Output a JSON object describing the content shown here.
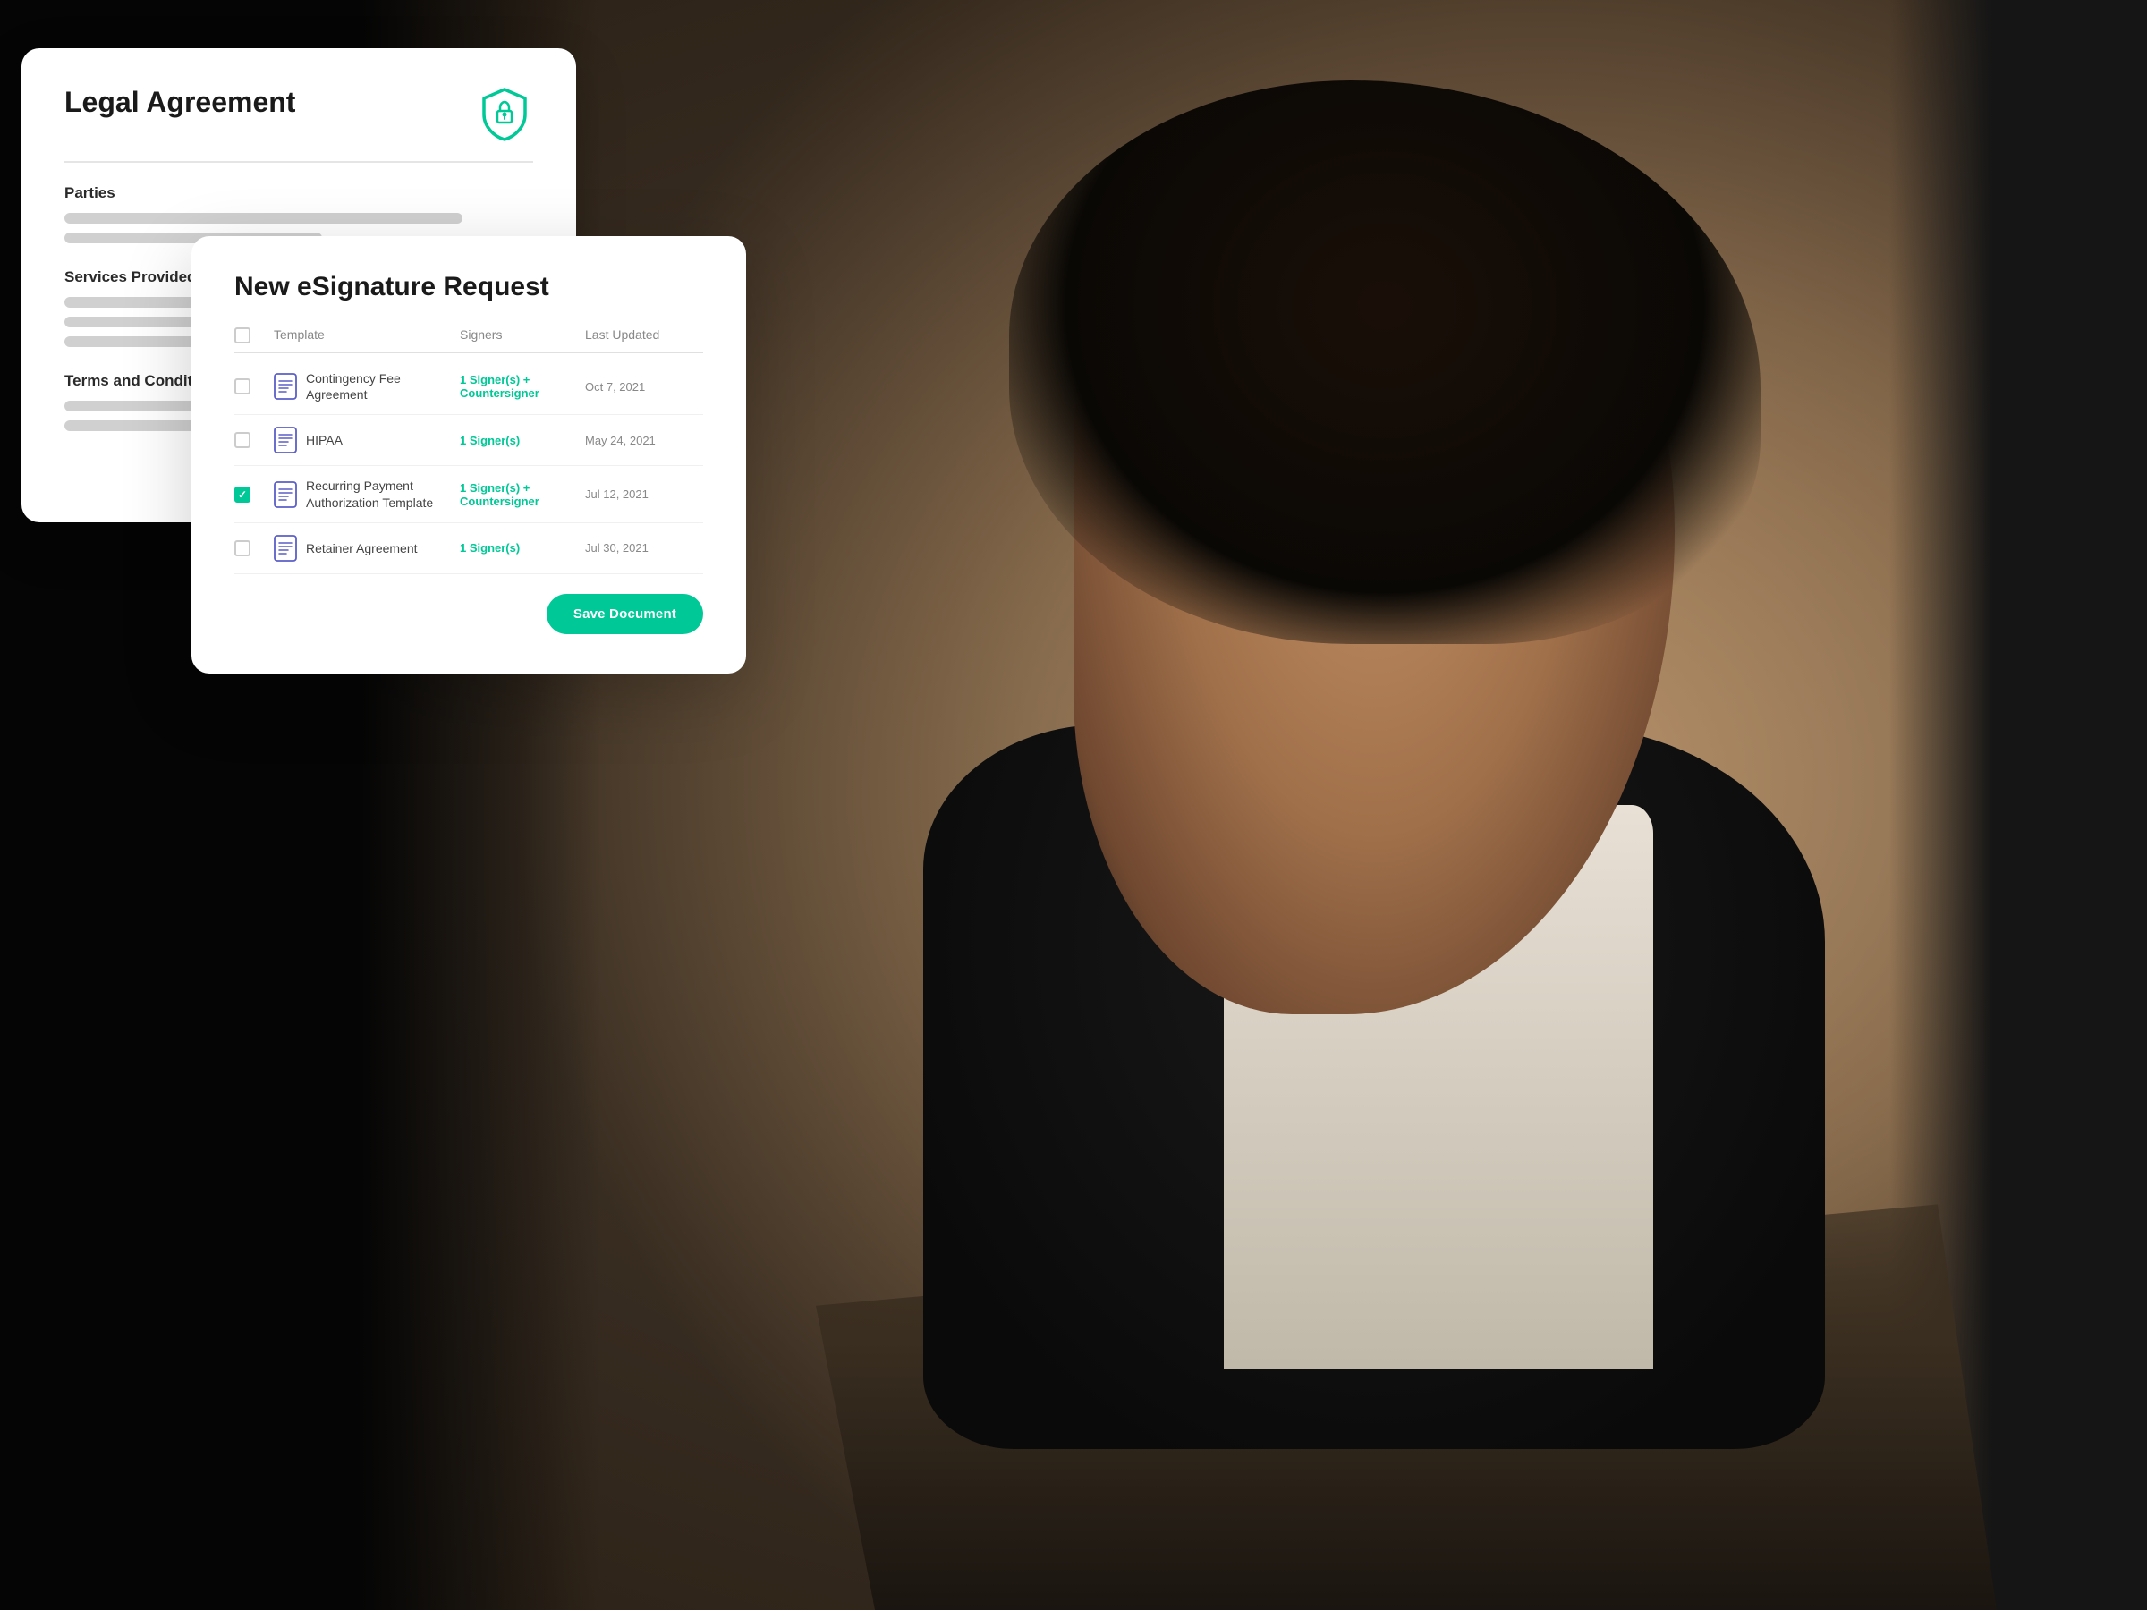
{
  "background": {
    "description": "Professional woman working on laptop, dark background"
  },
  "legal_card": {
    "title": "Legal Agreement",
    "sections": {
      "parties": {
        "label": "Parties",
        "lines": [
          "long",
          "medium"
        ]
      },
      "services": {
        "label": "Services Provided",
        "lines": [
          "short",
          "medium",
          "xshort"
        ]
      },
      "terms": {
        "label": "Terms and Conditions",
        "lines": [
          "long",
          "medium"
        ]
      }
    },
    "shield_icon": "shield-lock-icon"
  },
  "esignature_card": {
    "title": "New eSignature Request",
    "table": {
      "columns": [
        "",
        "Template",
        "Signers",
        "Last Updated"
      ],
      "rows": [
        {
          "checked": false,
          "template": "Contingency Fee Agreement",
          "signers": "1 Signer(s) + Countersigner",
          "last_updated": "Oct 7, 2021"
        },
        {
          "checked": false,
          "template": "HIPAA",
          "signers": "1 Signer(s)",
          "last_updated": "May 24, 2021"
        },
        {
          "checked": true,
          "template": "Recurring Payment Authorization Template",
          "signers": "1 Signer(s) + Countersigner",
          "last_updated": "Jul 12, 2021"
        },
        {
          "checked": false,
          "template": "Retainer Agreement",
          "signers": "1 Signer(s)",
          "last_updated": "Jul 30, 2021"
        }
      ]
    },
    "save_button_label": "Save Document"
  }
}
